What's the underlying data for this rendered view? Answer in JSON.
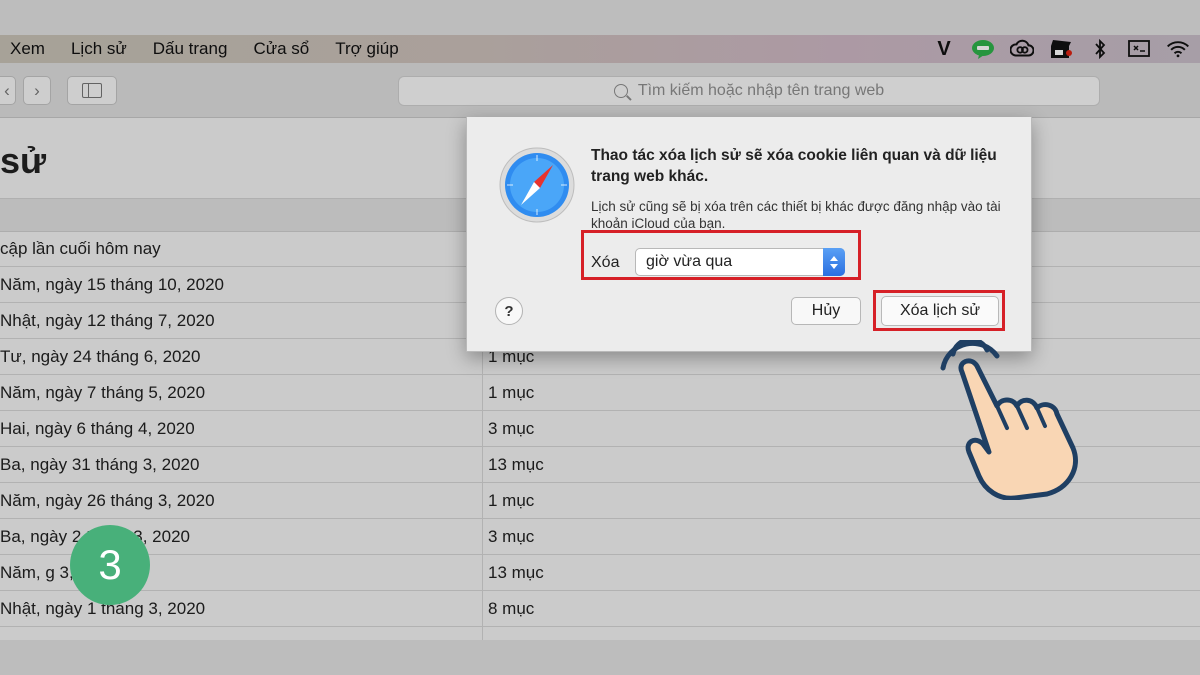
{
  "menu": [
    "Xem",
    "Lịch sử",
    "Dấu trang",
    "Cửa sổ",
    "Trợ giúp"
  ],
  "status_icons": [
    "v-icon",
    "line-icon",
    "creative-cloud-icon",
    "clapper-icon",
    "bluetooth-icon",
    "display-icon",
    "wifi-icon"
  ],
  "toolbar": {
    "back_icon": "‹",
    "forward_icon": "›",
    "address_placeholder": "Tìm kiếm hoặc nhập tên trang web"
  },
  "page": {
    "title": "sử",
    "rows": [
      {
        "date": "cập lần cuối hôm nay",
        "count": ""
      },
      {
        "date": "Năm, ngày 15 tháng 10, 2020",
        "count": ""
      },
      {
        "date": "Nhật, ngày 12 tháng 7, 2020",
        "count": ""
      },
      {
        "date": "Tư, ngày 24 tháng 6, 2020",
        "count": "1 mục"
      },
      {
        "date": "Năm, ngày 7 tháng 5, 2020",
        "count": "1 mục"
      },
      {
        "date": "Hai, ngày 6 tháng 4, 2020",
        "count": "3 mục"
      },
      {
        "date": "Ba, ngày 31 tháng 3, 2020",
        "count": "13 mục"
      },
      {
        "date": "Năm, ngày 26 tháng 3, 2020",
        "count": "1 mục"
      },
      {
        "date": "Ba, ngày 2  tháng 3, 2020",
        "count": "3 mục"
      },
      {
        "date": "Năm,          g 3, 2020",
        "count": "13 mục"
      },
      {
        "date": "Nhật, ngày 1 tháng 3, 2020",
        "count": "8 mục"
      }
    ]
  },
  "dialog": {
    "title": "Thao tác xóa lịch sử sẽ xóa cookie liên quan và dữ liệu trang web khác.",
    "subtitle": "Lịch sử cũng sẽ bị xóa trên các thiết bị khác được đăng nhập vào tài khoản iCloud của bạn.",
    "delete_label": "Xóa",
    "range_value": "giờ vừa qua",
    "help_label": "?",
    "cancel_label": "Hủy",
    "confirm_label": "Xóa lịch sử"
  },
  "step_badge": "3",
  "colors": {
    "highlight": "#d62027",
    "badge": "#48b07a",
    "stepper": "#2a6fe0",
    "hand_outline": "#1f3f63",
    "hand_fill": "#f9d6b4"
  }
}
